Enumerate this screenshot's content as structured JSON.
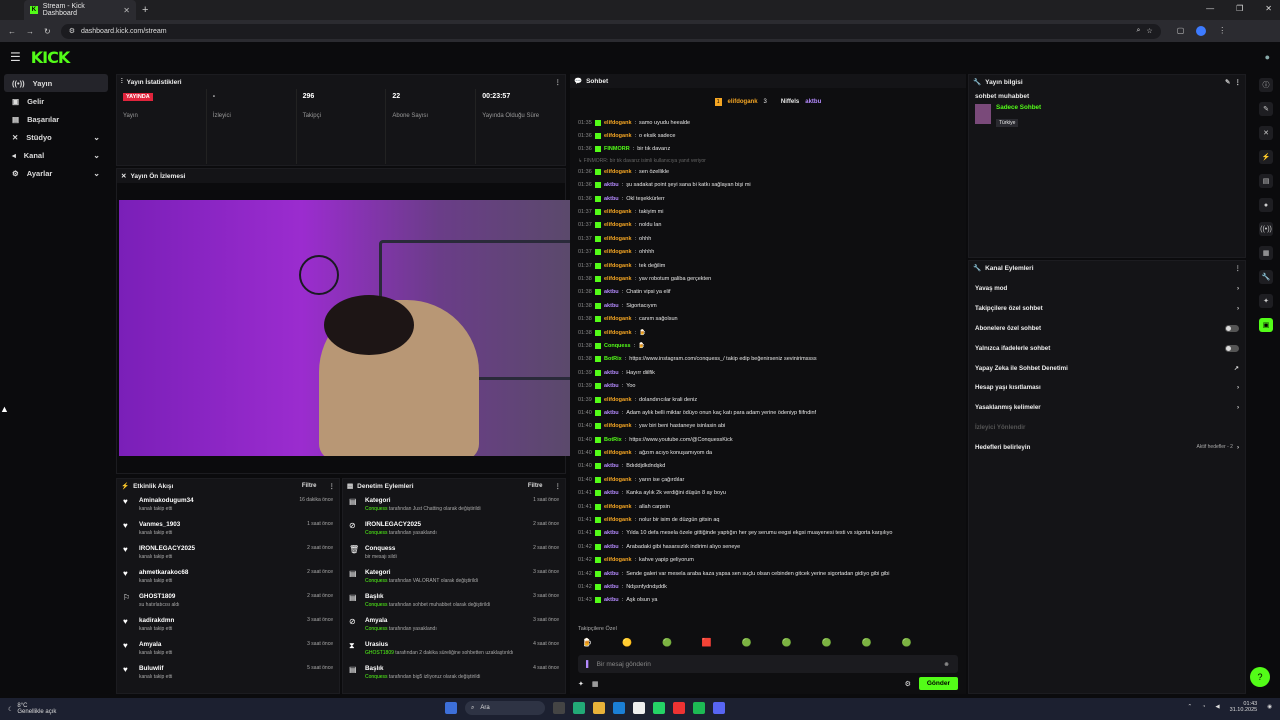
{
  "browser": {
    "tab_title": "Stream - Kick Dashboard",
    "url": "dashboard.kick.com/stream"
  },
  "brand": {
    "logo": "KICK",
    "accent": "#53fc18"
  },
  "sidebar": {
    "items": [
      {
        "label": "Yayın",
        "icon": "broadcast-icon"
      },
      {
        "label": "Gelir",
        "icon": "money-icon"
      },
      {
        "label": "Başarılar",
        "icon": "trophy-icon"
      },
      {
        "label": "Stüdyo",
        "icon": "studio-icon"
      },
      {
        "label": "Kanal",
        "icon": "channel-icon"
      },
      {
        "label": "Ayarlar",
        "icon": "gear-icon"
      }
    ]
  },
  "stats": {
    "title": "Yayın İstatistikleri",
    "live_badge": "YAYINDA",
    "items": [
      {
        "value": "",
        "label": "Yayın"
      },
      {
        "value": "-",
        "label": "İzleyici"
      },
      {
        "value": "296",
        "label": "Takipçi"
      },
      {
        "value": "22",
        "label": "Abone Sayısı"
      },
      {
        "value": "00:23:57",
        "label": "Yayında Olduğu Süre"
      }
    ]
  },
  "preview": {
    "title": "Yayın Ön İzlemesi"
  },
  "activity": {
    "title": "Etkinlik Akışı",
    "filter": "Filtre",
    "rows": [
      {
        "name": "Aminakodugum34",
        "sub": "kanalı takip etti",
        "time": "16 dakika önce"
      },
      {
        "name": "Vanmes_1903",
        "sub": "kanalı takip etti",
        "time": "1 saat önce"
      },
      {
        "name": "IRONLEGACY2025",
        "sub": "kanalı takip etti",
        "time": "2 saat önce"
      },
      {
        "name": "ahmetkarakoc68",
        "sub": "kanalı takip etti",
        "time": "2 saat önce"
      },
      {
        "name": "GHOST1809",
        "sub": "su hatırlatıcısı aldı",
        "time": "2 saat önce"
      },
      {
        "name": "kadirakdmn",
        "sub": "kanalı takip etti",
        "time": "3 saat önce"
      },
      {
        "name": "Amyala",
        "sub": "kanalı takip etti",
        "time": "3 saat önce"
      },
      {
        "name": "Buluwlif",
        "sub": "kanalı takip etti",
        "time": "5 saat önce"
      }
    ]
  },
  "moderation": {
    "title": "Denetim Eylemleri",
    "filter": "Filtre",
    "rows": [
      {
        "name": "Kategori",
        "actor": "Conquess",
        "sub": " tarafından Just Chatting olarak değiştirildi",
        "time": "1 saat önce"
      },
      {
        "name": "IRONLEGACY2025",
        "actor": "Conquess",
        "sub": " tarafından yasaklandı",
        "time": "2 saat önce"
      },
      {
        "name": "Conquess",
        "actor": "",
        "sub": "bir mesajı sildi",
        "time": "2 saat önce"
      },
      {
        "name": "Kategori",
        "actor": "Conquess",
        "sub": " tarafından VALORANT olarak değiştirildi",
        "time": "3 saat önce"
      },
      {
        "name": "Başlık",
        "actor": "Conquess",
        "sub": " tarafından sohbet muhabbet olarak değiştirildi",
        "time": "3 saat önce"
      },
      {
        "name": "Amyala",
        "actor": "Conquess",
        "sub": " tarafından yasaklandı",
        "time": "3 saat önce"
      },
      {
        "name": "Urasius",
        "actor": "GHOST1809",
        "sub": " tarafından 2 dakika süreliğine sohbetten uzaklaştırıldı",
        "time": "4 saat önce"
      },
      {
        "name": "Başlık",
        "actor": "Conquess",
        "sub": " tarafından big5 izliyoruz olarak değiştirildi",
        "time": "4 saat önce"
      }
    ]
  },
  "chat": {
    "title": "Sohbet",
    "pinned": {
      "user1": "elifdogank",
      "count1": "3",
      "user2": "Niffels",
      "user3": "aktbu"
    },
    "messages": [
      {
        "ts": "01:35",
        "user": "elifdogank",
        "color": "#f5a623",
        "text": "samo uyudu heealde"
      },
      {
        "ts": "01:36",
        "user": "elifdogank",
        "color": "#f5a623",
        "text": "o eksik sadece"
      },
      {
        "ts": "01:36",
        "user": "FINMORR",
        "color": "#53fc18",
        "text": "bir tık davarız"
      },
      {
        "ts": "",
        "user": "",
        "color": "#666",
        "text": "↳ FINMORR: bir tık davarız isimli kullanıcıya yanıt veriyor",
        "reply": true
      },
      {
        "ts": "01:36",
        "user": "elifdogank",
        "color": "#f5a623",
        "text": "sen özellikle"
      },
      {
        "ts": "01:36",
        "user": "aktbu",
        "color": "#b58bff",
        "text": "şu sadakat point şeyi sana bi katkı sağlayan bişi mi"
      },
      {
        "ts": "01:36",
        "user": "aktbu",
        "color": "#b58bff",
        "text": "Okl teşekkürlerr"
      },
      {
        "ts": "01:37",
        "user": "elifdogank",
        "color": "#f5a623",
        "text": "takiyim mi"
      },
      {
        "ts": "01:37",
        "user": "elifdogank",
        "color": "#f5a623",
        "text": "noldu lan"
      },
      {
        "ts": "01:37",
        "user": "elifdogank",
        "color": "#f5a623",
        "text": "ohhh"
      },
      {
        "ts": "01:37",
        "user": "elifdogank",
        "color": "#f5a623",
        "text": "ohhhh"
      },
      {
        "ts": "01:37",
        "user": "elifdogank",
        "color": "#f5a623",
        "text": "tek değilim"
      },
      {
        "ts": "01:38",
        "user": "elifdogank",
        "color": "#f5a623",
        "text": "yav robotum galiba gerçekten"
      },
      {
        "ts": "01:38",
        "user": "aktbu",
        "color": "#b58bff",
        "text": "Chatin vipsi ya elif"
      },
      {
        "ts": "01:38",
        "user": "aktbu",
        "color": "#b58bff",
        "text": "Sigortacıyım"
      },
      {
        "ts": "01:38",
        "user": "elifdogank",
        "color": "#f5a623",
        "text": "canım sağolsun"
      },
      {
        "ts": "01:38",
        "user": "elifdogank",
        "color": "#f5a623",
        "text": "🍺"
      },
      {
        "ts": "01:38",
        "user": "Conquess",
        "color": "#53fc18",
        "text": "🍺"
      },
      {
        "ts": "01:38",
        "user": "BotRix",
        "color": "#53fc18",
        "text": "https://www.instagram.com/conquess_/ takip edip beğenirseniz sevinirimssss"
      },
      {
        "ts": "01:39",
        "user": "aktbu",
        "color": "#b58bff",
        "text": "Hayırr diilfik"
      },
      {
        "ts": "01:39",
        "user": "aktbu",
        "color": "#b58bff",
        "text": "Yoo"
      },
      {
        "ts": "01:39",
        "user": "elifdogank",
        "color": "#f5a623",
        "text": "dolandırıcılar krali deniz"
      },
      {
        "ts": "01:40",
        "user": "aktbu",
        "color": "#b58bff",
        "text": "Adam aylık belli miktar ödüyo onun kaç katı para adam yerine ödeniyp fiifndinf"
      },
      {
        "ts": "01:40",
        "user": "elifdogank",
        "color": "#f5a623",
        "text": "yav biri beni hastaneye isinlasin abi"
      },
      {
        "ts": "01:40",
        "user": "BotRix",
        "color": "#53fc18",
        "text": "https://www.youtube.com/@ConquessKick"
      },
      {
        "ts": "01:40",
        "user": "elifdogank",
        "color": "#f5a623",
        "text": "ağzım acıyo konuşamıyom da"
      },
      {
        "ts": "01:40",
        "user": "aktbu",
        "color": "#b58bff",
        "text": "Bdıddjdkdndşkd"
      },
      {
        "ts": "01:40",
        "user": "elifdogank",
        "color": "#f5a623",
        "text": "yarın ise çağırdılar"
      },
      {
        "ts": "01:41",
        "user": "aktbu",
        "color": "#b58bff",
        "text": "Kanka aylık 2k verdiğini düşün 8 ay boyu"
      },
      {
        "ts": "01:41",
        "user": "elifdogank",
        "color": "#f5a623",
        "text": "allah carpsin"
      },
      {
        "ts": "01:41",
        "user": "elifdogank",
        "color": "#f5a623",
        "text": "nolur bir isim de düzgün gitsin aq"
      },
      {
        "ts": "01:41",
        "user": "aktbu",
        "color": "#b58bff",
        "text": "Yılda 10 defa mesela özele gittiğinde yaptığın her şey serumu eegsi ekgsi muayenesi testi vs sigorta karşılıyo"
      },
      {
        "ts": "01:42",
        "user": "aktbu",
        "color": "#b58bff",
        "text": "Arabadaki gibi hasarsızlık indirimi alıyo seneye"
      },
      {
        "ts": "01:42",
        "user": "elifdogank",
        "color": "#f5a623",
        "text": "kahve yapip geliyorum"
      },
      {
        "ts": "01:42",
        "user": "aktbu",
        "color": "#b58bff",
        "text": "Sende galeri var mesela araba kaza yapsa sen suçlu olsan cebinden gitcek yerine sigortadan gidiyo gibi gibi"
      },
      {
        "ts": "01:42",
        "user": "aktbu",
        "color": "#b58bff",
        "text": "Ndşsnfydndşddk"
      },
      {
        "ts": "01:43",
        "user": "aktbu",
        "color": "#b58bff",
        "text": "Aşk olsun ya"
      }
    ],
    "followers_only": "Takipçilere Özel",
    "input_placeholder": "Bir mesaj gönderin",
    "send_label": "Gönder"
  },
  "stream_info": {
    "title": "Yayın bilgisi",
    "stream_title": "sohbet muhabbet",
    "category": "Sadece Sohbet",
    "tag": "Türkiye"
  },
  "channel_actions": {
    "title": "Kanal Eylemleri",
    "items": [
      {
        "label": "Yavaş mod",
        "control": "chevron"
      },
      {
        "label": "Takipçilere özel sohbet",
        "control": "chevron"
      },
      {
        "label": "Abonelere özel sohbet",
        "control": "toggle"
      },
      {
        "label": "Yalnızca ifadelerle sohbet",
        "control": "toggle"
      },
      {
        "label": "Yapay Zeka ile Sohbet Denetimi",
        "control": "external"
      },
      {
        "label": "Hesap yaşı kısıtlaması",
        "control": "chevron"
      },
      {
        "label": "Yasaklanmış kelimeler",
        "control": "chevron"
      },
      {
        "label": "İzleyici Yönlendir",
        "control": "none",
        "disabled": true
      },
      {
        "label": "Hedefleri belirleyin",
        "control": "chevron",
        "extra": "Aktif hedefler - 2"
      }
    ]
  },
  "taskbar": {
    "weather_temp": "8°C",
    "weather_desc": "Genellikle açık",
    "search": "Ara",
    "time": "01:43",
    "date": "31.10.2025"
  }
}
